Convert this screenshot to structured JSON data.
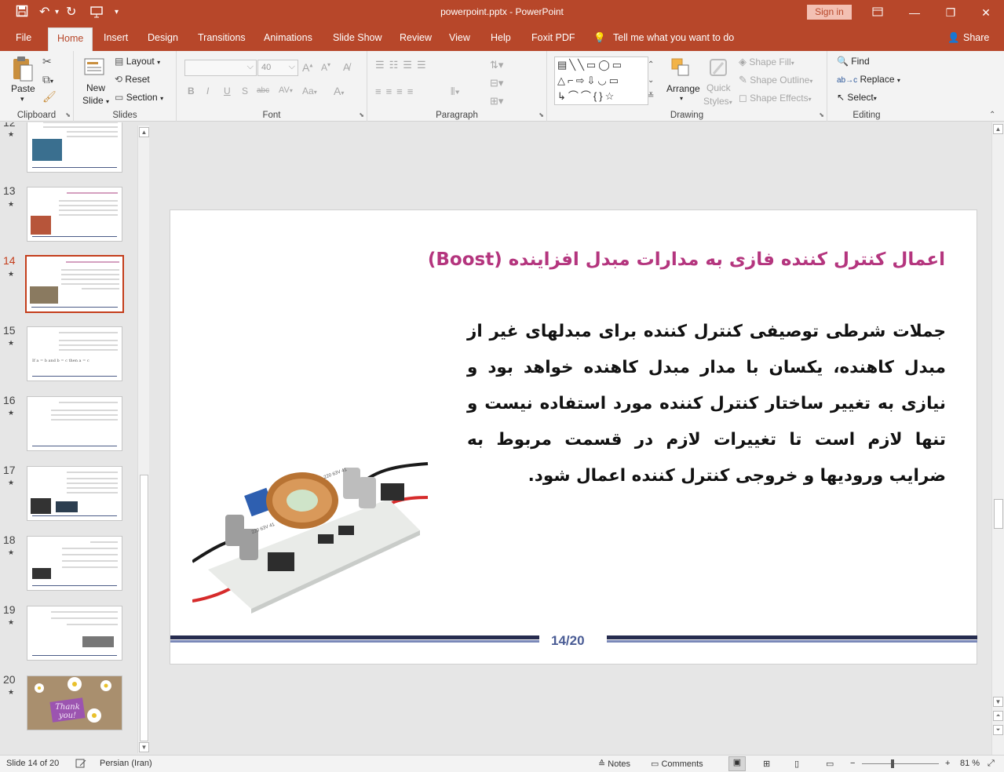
{
  "window": {
    "title": "powerpoint.pptx  -  PowerPoint",
    "signin_label": "Sign in"
  },
  "qat": {
    "save_icon": "save-icon",
    "undo_icon": "undo-icon",
    "redo_icon": "repeat-icon",
    "present_icon": "present-from-start-icon",
    "customize_icon": "customize-qat-icon"
  },
  "menu": {
    "tabs": [
      "File",
      "Home",
      "Insert",
      "Design",
      "Transitions",
      "Animations",
      "Slide Show",
      "Review",
      "View",
      "Help",
      "Foxit PDF"
    ],
    "active_tab": "Home",
    "tell_me": "Tell me what you want to do",
    "share": "Share"
  },
  "ribbon": {
    "clipboard": {
      "label": "Clipboard",
      "paste": "Paste"
    },
    "slides": {
      "label": "Slides",
      "new_slide_line1": "New",
      "new_slide_line2": "Slide",
      "layout": "Layout",
      "reset": "Reset",
      "section": "Section"
    },
    "font": {
      "label": "Font",
      "font_name": "",
      "font_size": "40",
      "bold": "B",
      "italic": "I",
      "underline": "U",
      "shadow": "S",
      "strike": "abc",
      "spacing": "AV",
      "case": "Aa",
      "grow": "A",
      "shrink": "A",
      "color": "A"
    },
    "paragraph": {
      "label": "Paragraph"
    },
    "drawing": {
      "label": "Drawing",
      "arrange": "Arrange",
      "quick_styles_1": "Quick",
      "quick_styles_2": "Styles",
      "shape_fill": "Shape Fill",
      "shape_outline": "Shape Outline",
      "shape_effects": "Shape Effects"
    },
    "editing": {
      "label": "Editing",
      "find": "Find",
      "replace": "Replace",
      "select": "Select"
    }
  },
  "thumbnails": [
    {
      "num": "12",
      "selected": false
    },
    {
      "num": "13",
      "selected": false
    },
    {
      "num": "14",
      "selected": true
    },
    {
      "num": "15",
      "selected": false
    },
    {
      "num": "16",
      "selected": false
    },
    {
      "num": "17",
      "selected": false
    },
    {
      "num": "18",
      "selected": false
    },
    {
      "num": "19",
      "selected": false
    },
    {
      "num": "20",
      "selected": false
    }
  ],
  "thumb15_text": "If a = b and b = c then a = c",
  "thumb20_text": "Thank you!",
  "slide": {
    "title": "اعمال کنترل کننده فازی به مدارات مبدل افزاینده (Boost)",
    "body": "جملات شرطی توصیفی کنترل کننده برای مبدلهای غیر از مبدل کاهنده، یکسان با مدار مبدل کاهنده خواهد بود و نیازی به تغییر ساختار کنترل کننده مورد استفاده نیست و تنها لازم است تا تغییرات لازم در قسمت مربوط به ضرایب ورودیها و خروجی کنترل کننده اعمال شود.",
    "number": "14/20",
    "capacitor_labels": [
      "220 63V 41",
      "220 63V 41"
    ]
  },
  "status": {
    "slide_info": "Slide 14 of 20",
    "language": "Persian (Iran)",
    "notes": "Notes",
    "comments": "Comments",
    "zoom": "81 %",
    "zoom_minus": "−",
    "zoom_plus": "+"
  },
  "colors": {
    "accent": "#b7472a",
    "title": "#b4357e",
    "footer": "#262c4f"
  }
}
